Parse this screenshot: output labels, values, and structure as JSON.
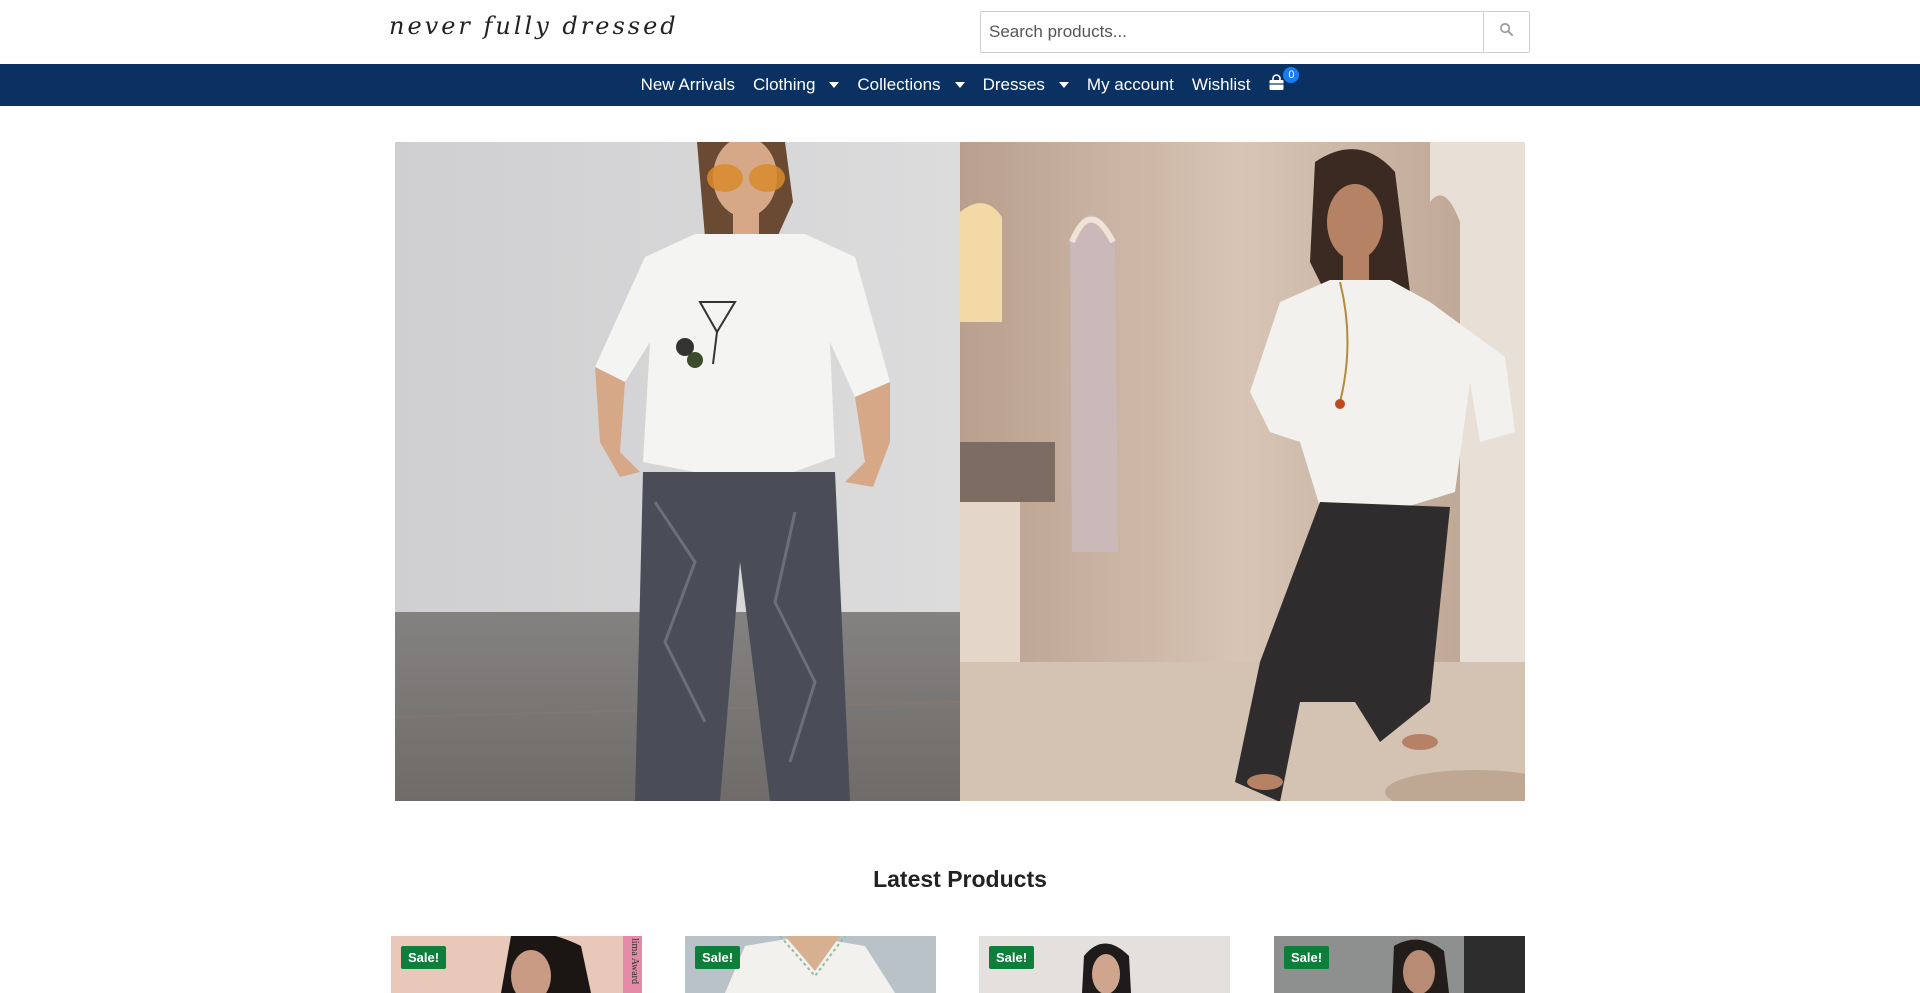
{
  "brand": {
    "logo_text": "never fully dressed"
  },
  "search": {
    "placeholder": "Search products..."
  },
  "nav": {
    "items": [
      {
        "label": "New Arrivals",
        "has_dropdown": false
      },
      {
        "label": "Clothing",
        "has_dropdown": true
      },
      {
        "label": "Collections",
        "has_dropdown": true
      },
      {
        "label": "Dresses",
        "has_dropdown": true
      },
      {
        "label": "My account",
        "has_dropdown": false
      },
      {
        "label": "Wishlist",
        "has_dropdown": false
      }
    ],
    "cart_count": "0"
  },
  "sections": {
    "latest_title": "Latest Products"
  },
  "products": [
    {
      "badge": "Sale!",
      "side_text": "lima Award"
    },
    {
      "badge": "Sale!"
    },
    {
      "badge": "Sale!"
    },
    {
      "badge": "Sale!"
    }
  ],
  "colors": {
    "nav_bg": "#0a3161",
    "sale_badge": "#0e7f3b",
    "cart_badge": "#1a7cf0"
  },
  "icons": {
    "search": "search-icon",
    "cart": "shopping-bag-icon",
    "dropdown": "caret-down-icon"
  }
}
